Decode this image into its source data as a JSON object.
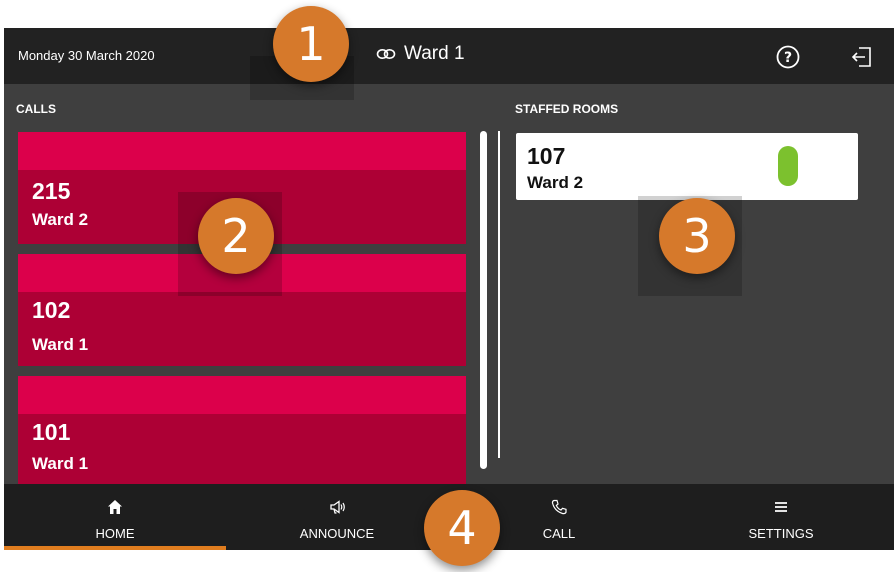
{
  "header": {
    "date": "Monday 30 March 2020",
    "ward_title": "Ward 1",
    "help_icon": "help-circle-icon",
    "logout_icon": "logout-icon",
    "link_icon": "link-icon"
  },
  "calls": {
    "title": "CALLS",
    "items": [
      {
        "room": "215",
        "ward": "Ward 2"
      },
      {
        "room": "102",
        "ward": "Ward 1"
      },
      {
        "room": "101",
        "ward": "Ward 1"
      }
    ]
  },
  "staffed": {
    "title": "STAFFED ROOMS",
    "items": [
      {
        "room": "107",
        "ward": "Ward 2"
      }
    ]
  },
  "nav": {
    "items": [
      {
        "label": "HOME",
        "icon": "home-icon"
      },
      {
        "label": "ANNOUNCE",
        "icon": "megaphone-icon"
      },
      {
        "label": "CALL",
        "icon": "phone-icon"
      },
      {
        "label": "SETTINGS",
        "icon": "menu-icon"
      }
    ]
  },
  "markers": [
    "1",
    "2",
    "3",
    "4"
  ],
  "colors": {
    "call_card": "#ad0035",
    "call_card_stripe": "#dc004b",
    "presence": "#7cc12e",
    "accent": "#e07d1f",
    "marker": "#d6792b"
  }
}
